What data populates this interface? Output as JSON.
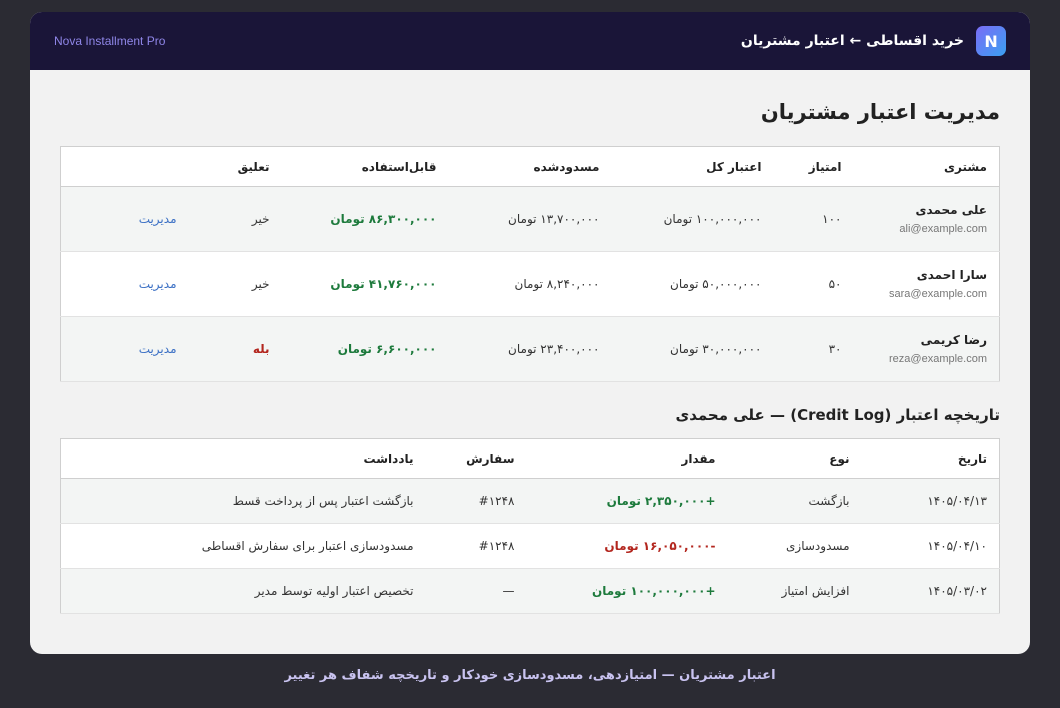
{
  "header": {
    "logo_letter": "N",
    "breadcrumb": "خرید اقساطی ← اعتبار مشتریان",
    "product_name": "Nova Installment Pro"
  },
  "page_title": "مدیریت اعتبار مشتریان",
  "customers_table": {
    "columns": [
      "مشتری",
      "امتیاز",
      "اعتبار کل",
      "مسدودشده",
      "قابل‌استفاده",
      "تعلیق",
      ""
    ],
    "rows": [
      {
        "name": "علی محمدی",
        "email": "ali@example.com",
        "score": "۱۰۰",
        "total": "۱۰۰,۰۰۰,۰۰۰ تومان",
        "blocked": "۱۳,۷۰۰,۰۰۰ تومان",
        "available": "۸۶,۳۰۰,۰۰۰ تومان",
        "suspended": "خیر",
        "action": "مدیریت"
      },
      {
        "name": "سارا احمدی",
        "email": "sara@example.com",
        "score": "۵۰",
        "total": "۵۰,۰۰۰,۰۰۰ تومان",
        "blocked": "۸,۲۴۰,۰۰۰ تومان",
        "available": "۴۱,۷۶۰,۰۰۰ تومان",
        "suspended": "خیر",
        "action": "مدیریت"
      },
      {
        "name": "رضا کریمی",
        "email": "reza@example.com",
        "score": "۳۰",
        "total": "۳۰,۰۰۰,۰۰۰ تومان",
        "blocked": "۲۳,۴۰۰,۰۰۰ تومان",
        "available": "۶,۶۰۰,۰۰۰ تومان",
        "suspended": "بله",
        "action": "مدیریت"
      }
    ]
  },
  "log_section_title": "تاریخچه اعتبار (Credit Log) — علی محمدی",
  "log_table": {
    "columns": [
      "تاریخ",
      "نوع",
      "مقدار",
      "سفارش",
      "یادداشت"
    ],
    "rows": [
      {
        "date": "۱۴۰۵/۰۴/۱۳",
        "type": "بازگشت",
        "amount": "+۲,۳۵۰,۰۰۰ تومان",
        "order": "#۱۲۴۸",
        "note": "بازگشت اعتبار پس از پرداخت قسط"
      },
      {
        "date": "۱۴۰۵/۰۴/۱۰",
        "type": "مسدودسازی",
        "amount": "-۱۶,۰۵۰,۰۰۰ تومان",
        "order": "#۱۲۴۸",
        "note": "مسدودسازی اعتبار برای سفارش اقساطی"
      },
      {
        "date": "۱۴۰۵/۰۳/۰۲",
        "type": "افزایش امتیاز",
        "amount": "+۱۰۰,۰۰۰,۰۰۰ تومان",
        "order": "—",
        "note": "تخصیص اعتبار اولیه توسط مدیر"
      }
    ]
  },
  "footer_caption": "اعتبار مشتریان — امتیازدهی، مسدودسازی خودکار و تاریخچه شفاف هر تغییر"
}
